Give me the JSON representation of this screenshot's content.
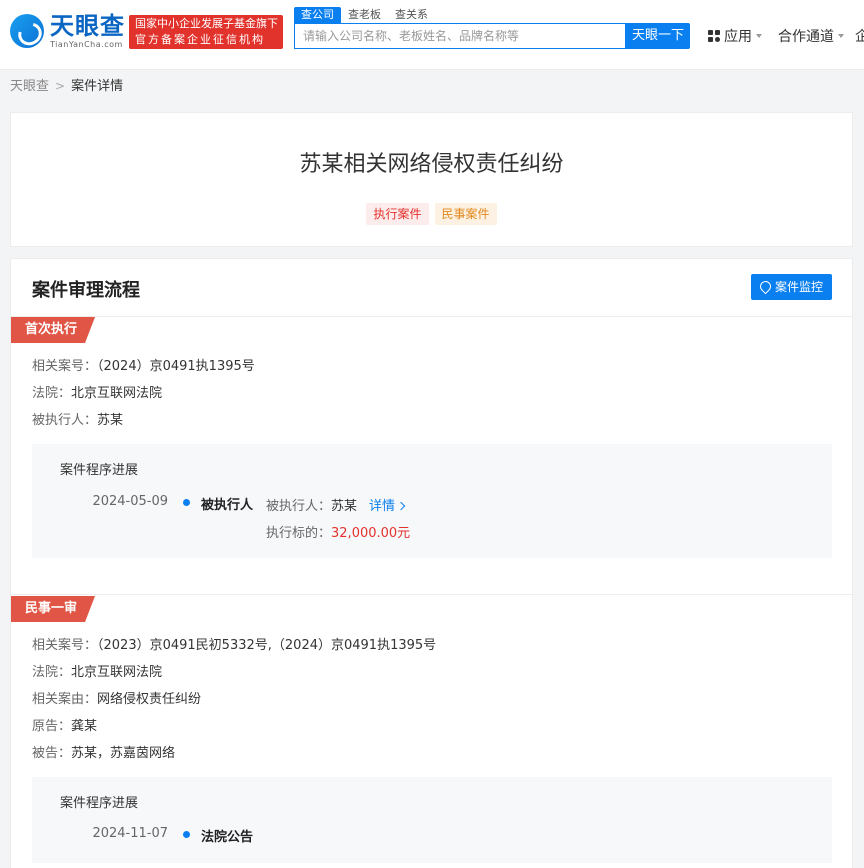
{
  "header": {
    "logo_text": "天眼查",
    "logo_sub": "TianYanCha.com",
    "badge_line1": "国家中小企业发展子基金旗下",
    "badge_line2": "官方备案企业征信机构",
    "search_tabs": [
      "查公司",
      "查老板",
      "查关系"
    ],
    "search_placeholder": "请输入公司名称、老板姓名、品牌名称等",
    "search_button": "天眼一下",
    "nav_apps": "应用",
    "nav_partner": "合作通道",
    "nav_cut": "企"
  },
  "breadcrumb": {
    "home": "天眼查",
    "current": "案件详情"
  },
  "case": {
    "title": "苏某相关网络侵权责任纠纷",
    "tags": [
      "执行案件",
      "民事案件"
    ]
  },
  "process": {
    "title": "案件审理流程",
    "monitor_button": "案件监控",
    "sections": [
      {
        "label": "首次执行",
        "info": [
          {
            "k": "相关案号：",
            "v": "（2024）京0491执1395号"
          },
          {
            "k": "法院：",
            "v": "北京互联网法院"
          },
          {
            "k": "被执行人：",
            "v": "苏某"
          }
        ],
        "progress_title": "案件程序进展",
        "entry": {
          "date": "2024-05-09",
          "event": "被执行人",
          "detail1_k": "被执行人：",
          "detail1_v": "苏某",
          "link": "详情",
          "detail2_k": "执行标的：",
          "detail2_v": "32,000.00元"
        }
      },
      {
        "label": "民事一审",
        "info": [
          {
            "k": "相关案号：",
            "v": "（2023）京0491民初5332号,（2024）京0491执1395号"
          },
          {
            "k": "法院：",
            "v": "北京互联网法院"
          },
          {
            "k": "相关案由：",
            "v": "网络侵权责任纠纷"
          },
          {
            "k": "原告：",
            "v": "龚某"
          },
          {
            "k": "被告：",
            "v": "苏某，苏嘉茵网络"
          }
        ],
        "progress_title": "案件程序进展",
        "entry": {
          "date": "2024-11-07",
          "event": "法院公告"
        }
      }
    ]
  }
}
